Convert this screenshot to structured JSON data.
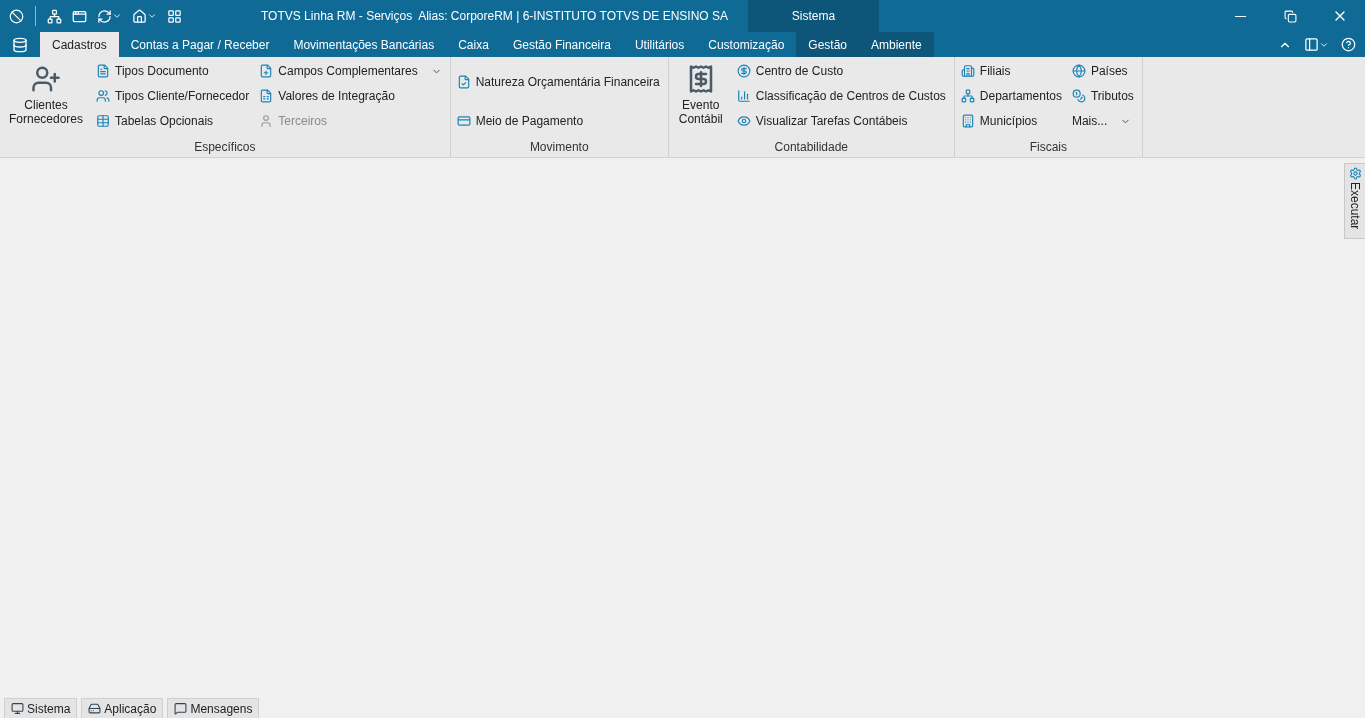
{
  "window": {
    "title": "TOTVS Linha RM - Serviços  Alias: CorporeRM | 6-INSTITUTO TOTVS DE ENSINO SA",
    "context_label": "Sistema"
  },
  "tabs": [
    {
      "label": "Cadastros",
      "selected": true,
      "context": false
    },
    {
      "label": "Contas a Pagar / Receber",
      "selected": false,
      "context": false
    },
    {
      "label": "Movimentações Bancárias",
      "selected": false,
      "context": false
    },
    {
      "label": "Caixa",
      "selected": false,
      "context": false
    },
    {
      "label": "Gestão Financeira",
      "selected": false,
      "context": false
    },
    {
      "label": "Utilitários",
      "selected": false,
      "context": false
    },
    {
      "label": "Customização",
      "selected": false,
      "context": false
    },
    {
      "label": "Gestão",
      "selected": false,
      "context": true
    },
    {
      "label": "Ambiente",
      "selected": false,
      "context": true
    }
  ],
  "ribbon_groups": [
    {
      "title": "Específicos",
      "large": "Clientes Fornecedores",
      "columns": [
        [
          {
            "label": "Tipos Documento",
            "disabled": false,
            "dropdown": false
          },
          {
            "label": "Tipos Cliente/Fornecedor",
            "disabled": false,
            "dropdown": false
          },
          {
            "label": "Tabelas Opcionais",
            "disabled": false,
            "dropdown": false
          }
        ],
        [
          {
            "label": "Campos Complementares",
            "disabled": false,
            "dropdown": true
          },
          {
            "label": "Valores de Integração",
            "disabled": false,
            "dropdown": false
          },
          {
            "label": "Terceiros",
            "disabled": true,
            "dropdown": false
          }
        ]
      ]
    },
    {
      "title": "Movimento",
      "columns": [
        [
          {
            "label": "Natureza Orçamentária Financeira",
            "disabled": false,
            "dropdown": false
          },
          {
            "label": "Meio de Pagamento",
            "disabled": false,
            "dropdown": false
          }
        ]
      ]
    },
    {
      "title": "Contabilidade",
      "large": "Evento Contábil",
      "columns": [
        [
          {
            "label": "Centro de Custo",
            "disabled": false,
            "dropdown": false
          },
          {
            "label": "Classificação de Centros de Custos",
            "disabled": false,
            "dropdown": false
          },
          {
            "label": "Visualizar Tarefas Contábeis",
            "disabled": false,
            "dropdown": false
          }
        ]
      ]
    },
    {
      "title": "Fiscais",
      "columns": [
        [
          {
            "label": "Filiais",
            "disabled": false,
            "dropdown": false
          },
          {
            "label": "Departamentos",
            "disabled": false,
            "dropdown": false
          },
          {
            "label": "Municípios",
            "disabled": false,
            "dropdown": false
          }
        ],
        [
          {
            "label": "Países",
            "disabled": false,
            "dropdown": false
          },
          {
            "label": "Tributos",
            "disabled": false,
            "dropdown": false
          },
          {
            "label": "Mais...",
            "disabled": false,
            "dropdown": true
          }
        ]
      ]
    }
  ],
  "side_panel": {
    "label": "Executar"
  },
  "bottom_tabs": [
    {
      "label": "Sistema"
    },
    {
      "label": "Aplicação"
    },
    {
      "label": "Mensagens"
    }
  ]
}
